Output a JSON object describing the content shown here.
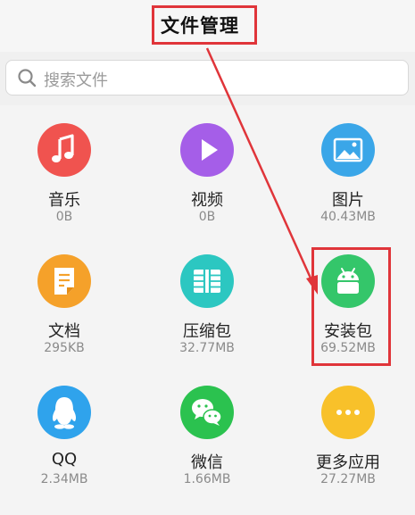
{
  "header": {
    "title": "文件管理"
  },
  "search": {
    "placeholder": "搜索文件"
  },
  "categories": [
    {
      "name": "音乐",
      "size": "0B",
      "icon": "music-note-icon",
      "color": "#f0534f"
    },
    {
      "name": "视频",
      "size": "0B",
      "icon": "play-icon",
      "color": "#a55ee8"
    },
    {
      "name": "图片",
      "size": "40.43MB",
      "icon": "image-icon",
      "color": "#3aa6e8"
    },
    {
      "name": "文档",
      "size": "295KB",
      "icon": "document-icon",
      "color": "#f5a12a"
    },
    {
      "name": "压缩包",
      "size": "32.77MB",
      "icon": "archive-icon",
      "color": "#2cc7c1"
    },
    {
      "name": "安装包",
      "size": "69.52MB",
      "icon": "android-icon",
      "color": "#34c66a"
    },
    {
      "name": "QQ",
      "size": "2.34MB",
      "icon": "qq-penguin-icon",
      "color": "#2fa3ec"
    },
    {
      "name": "微信",
      "size": "1.66MB",
      "icon": "wechat-icon",
      "color": "#2bc24f"
    },
    {
      "name": "更多应用",
      "size": "27.27MB",
      "icon": "more-apps-icon",
      "color": "#f8c12a"
    }
  ],
  "annotation_color": "#e0353a"
}
